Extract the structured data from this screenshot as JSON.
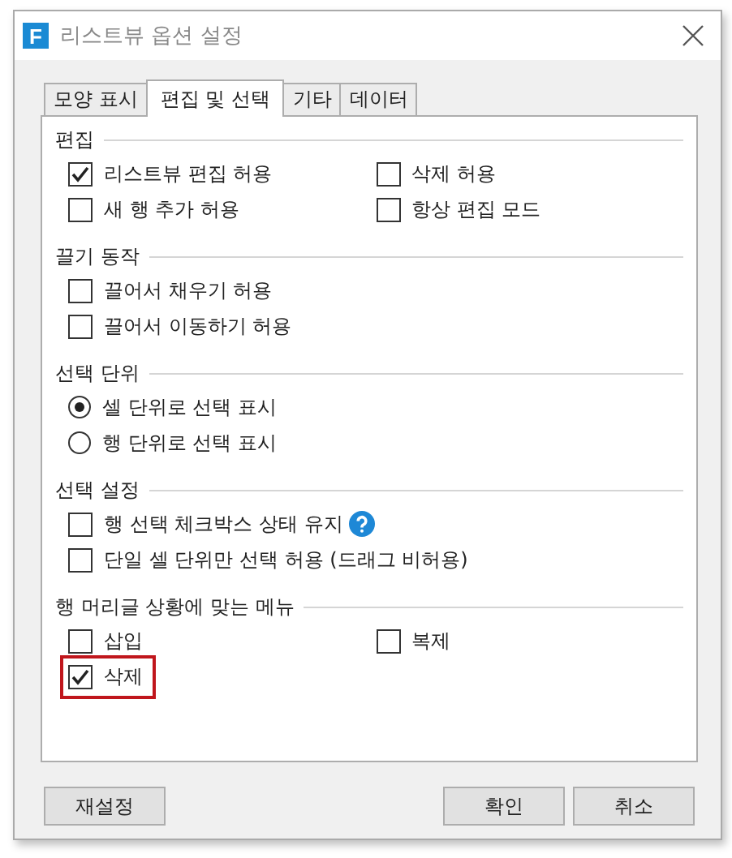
{
  "window": {
    "title": "리스트뷰 옵션 설정",
    "logo": "F"
  },
  "tabs": [
    {
      "label": "모양 표시",
      "selected": false
    },
    {
      "label": "편집 및 선택",
      "selected": true
    },
    {
      "label": "기타",
      "selected": false
    },
    {
      "label": "데이터",
      "selected": false
    }
  ],
  "sections": [
    {
      "title": "편집",
      "kind": "grid",
      "items": [
        {
          "kind": "checkbox",
          "label": "리스트뷰 편집 허용",
          "checked": true
        },
        {
          "kind": "checkbox",
          "label": "삭제 허용",
          "checked": false
        },
        {
          "kind": "checkbox",
          "label": "새 행 추가 허용",
          "checked": false
        },
        {
          "kind": "checkbox",
          "label": "항상 편집 모드",
          "checked": false
        }
      ]
    },
    {
      "title": "끌기 동작",
      "kind": "list",
      "items": [
        {
          "kind": "checkbox",
          "label": "끌어서 채우기 허용",
          "checked": false
        },
        {
          "kind": "checkbox",
          "label": "끌어서 이동하기 허용",
          "checked": false
        }
      ]
    },
    {
      "title": "선택 단위",
      "kind": "list",
      "items": [
        {
          "kind": "radio",
          "label": "셀 단위로 선택 표시",
          "selected": true
        },
        {
          "kind": "radio",
          "label": "행 단위로 선택 표시",
          "selected": false
        }
      ]
    },
    {
      "title": "선택 설정",
      "kind": "list",
      "items": [
        {
          "kind": "checkbox",
          "label": "행 선택 체크박스 상태 유지",
          "checked": false,
          "help": true
        },
        {
          "kind": "checkbox",
          "label": "단일 셀 단위만 선택 허용 (드래그 비허용)",
          "checked": false
        }
      ]
    },
    {
      "title": "행 머리글 상황에 맞는 메뉴",
      "kind": "grid",
      "items": [
        {
          "kind": "checkbox",
          "label": "삽입",
          "checked": false
        },
        {
          "kind": "checkbox",
          "label": "복제",
          "checked": false
        },
        {
          "kind": "checkbox",
          "label": "삭제",
          "checked": true,
          "highlighted": true
        }
      ]
    }
  ],
  "buttons": {
    "left": [
      "재설정"
    ],
    "right": [
      "확인",
      "취소"
    ]
  }
}
